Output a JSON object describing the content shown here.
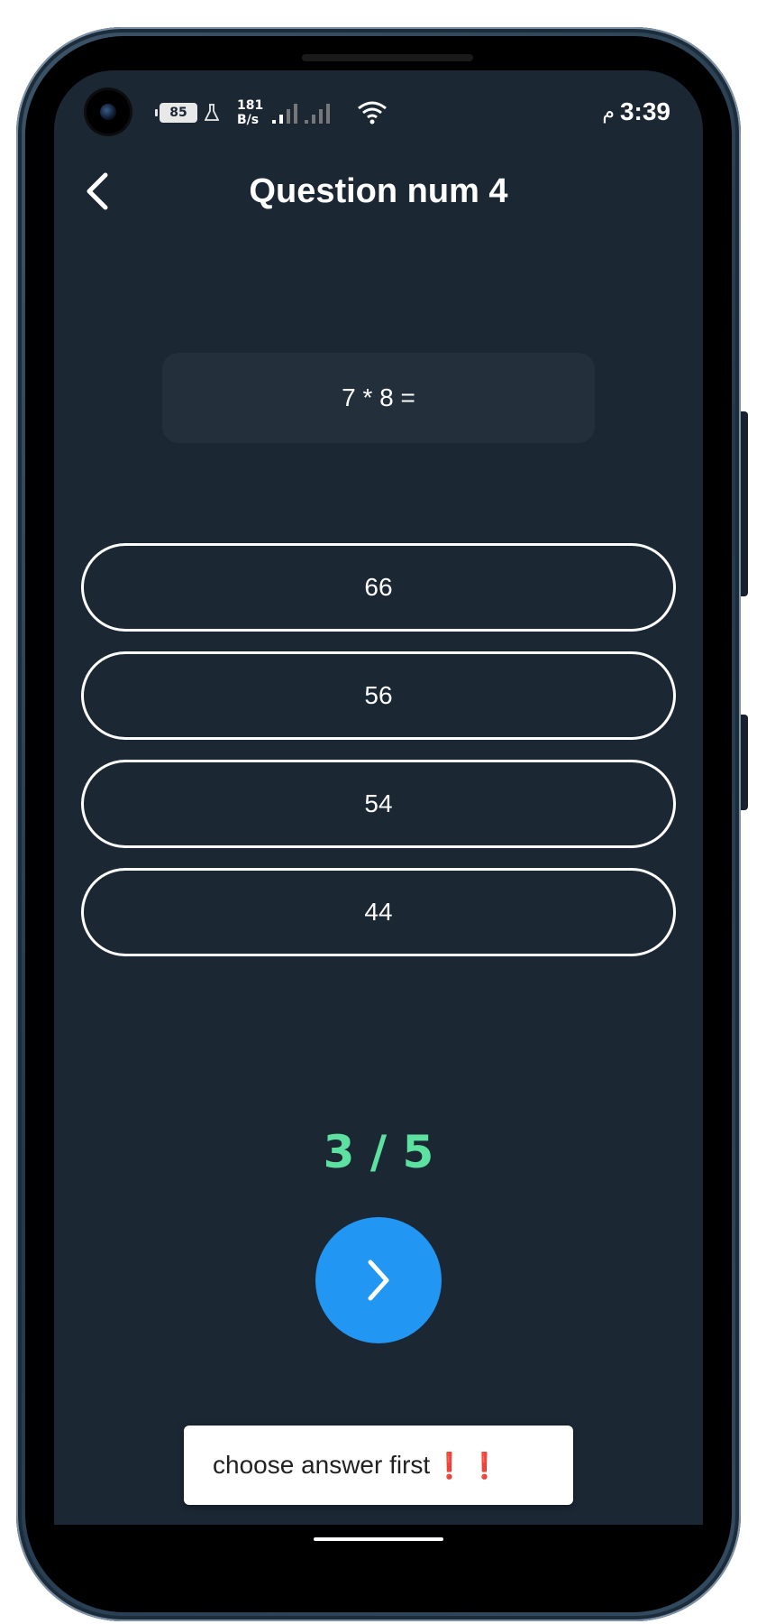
{
  "status_bar": {
    "battery_level": "85",
    "network_speed_value": "181",
    "network_speed_unit": "B/s",
    "ampm": "م",
    "time": "3:39"
  },
  "header": {
    "title": "Question num 4"
  },
  "question": {
    "text": "7 * 8 ="
  },
  "answers": [
    {
      "label": "66"
    },
    {
      "label": "56"
    },
    {
      "label": "54"
    },
    {
      "label": "44"
    }
  ],
  "score": {
    "text": "3 / 5"
  },
  "toast": {
    "message": "choose answer first",
    "emoji": "❗❗"
  },
  "colors": {
    "background": "#1b2733",
    "question_box": "#232f3b",
    "score": "#5ce1a0",
    "next_button": "#2196f3",
    "toast_bg": "#ffffff"
  },
  "icons": {
    "back": "chevron-left-icon",
    "next": "chevron-right-icon"
  }
}
